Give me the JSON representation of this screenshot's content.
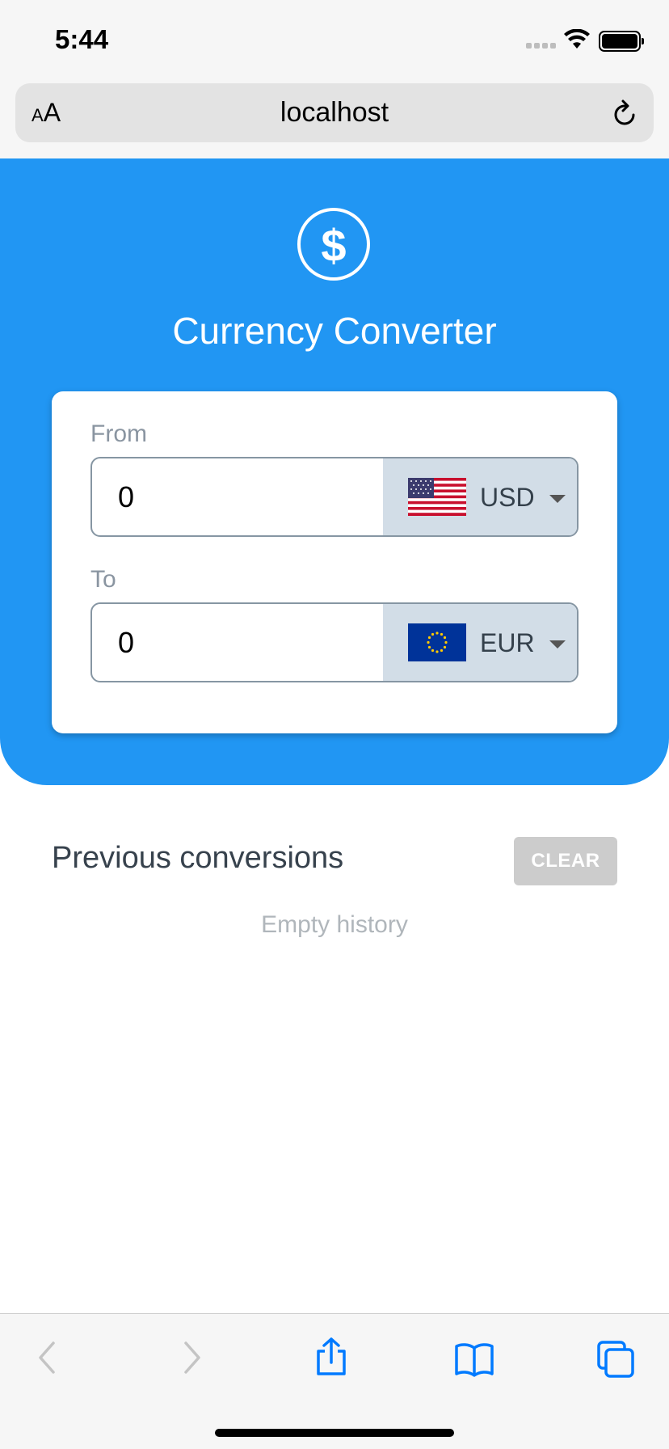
{
  "status_bar": {
    "time": "5:44"
  },
  "browser": {
    "text_size_small": "A",
    "text_size_big": "A",
    "url": "localhost"
  },
  "app": {
    "title": "Currency Converter"
  },
  "converter": {
    "from": {
      "label": "From",
      "amount": "0",
      "currency": "USD"
    },
    "to": {
      "label": "To",
      "amount": "0",
      "currency": "EUR"
    }
  },
  "history": {
    "title": "Previous conversions",
    "clear_label": "CLEAR",
    "empty_text": "Empty history"
  },
  "colors": {
    "primary": "#2196f3",
    "select_bg": "#d2dde7",
    "ios_blue": "#007aff"
  }
}
